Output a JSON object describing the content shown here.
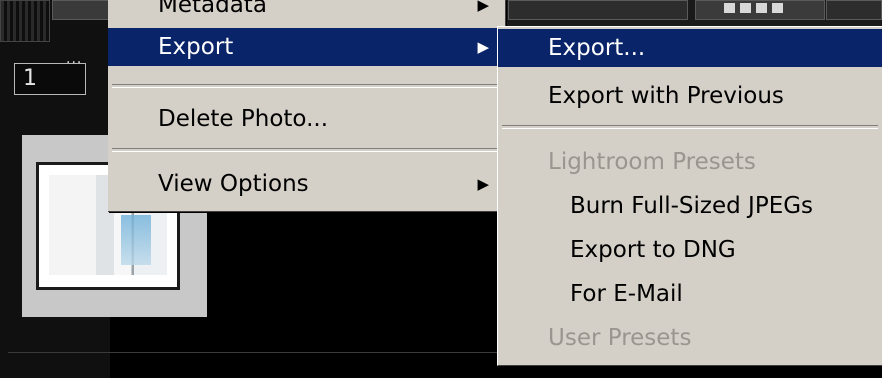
{
  "menu": {
    "items": [
      {
        "label": "Metadata",
        "has_submenu": true
      },
      {
        "label": "Export",
        "has_submenu": true,
        "highlighted": true
      },
      {
        "label": "Delete Photo...",
        "has_submenu": false
      },
      {
        "label": "View Options",
        "has_submenu": true
      }
    ]
  },
  "submenu": {
    "items": [
      {
        "label": "Export...",
        "highlighted": true
      },
      {
        "label": "Export with Previous"
      },
      {
        "label": "Lightroom Presets",
        "disabled": true
      },
      {
        "label": "Burn Full-Sized JPEGs"
      },
      {
        "label": "Export to DNG"
      },
      {
        "label": "For E-Mail"
      },
      {
        "label": "User Presets",
        "disabled": true
      }
    ]
  },
  "filmstrip": {
    "badge": "1",
    "badge_dots": "..."
  },
  "icons": {
    "submenu_arrow": "▶"
  },
  "colors": {
    "menu_bg": "#d4d0c8",
    "highlight": "#0a246a",
    "disabled_text": "#9a968f"
  }
}
